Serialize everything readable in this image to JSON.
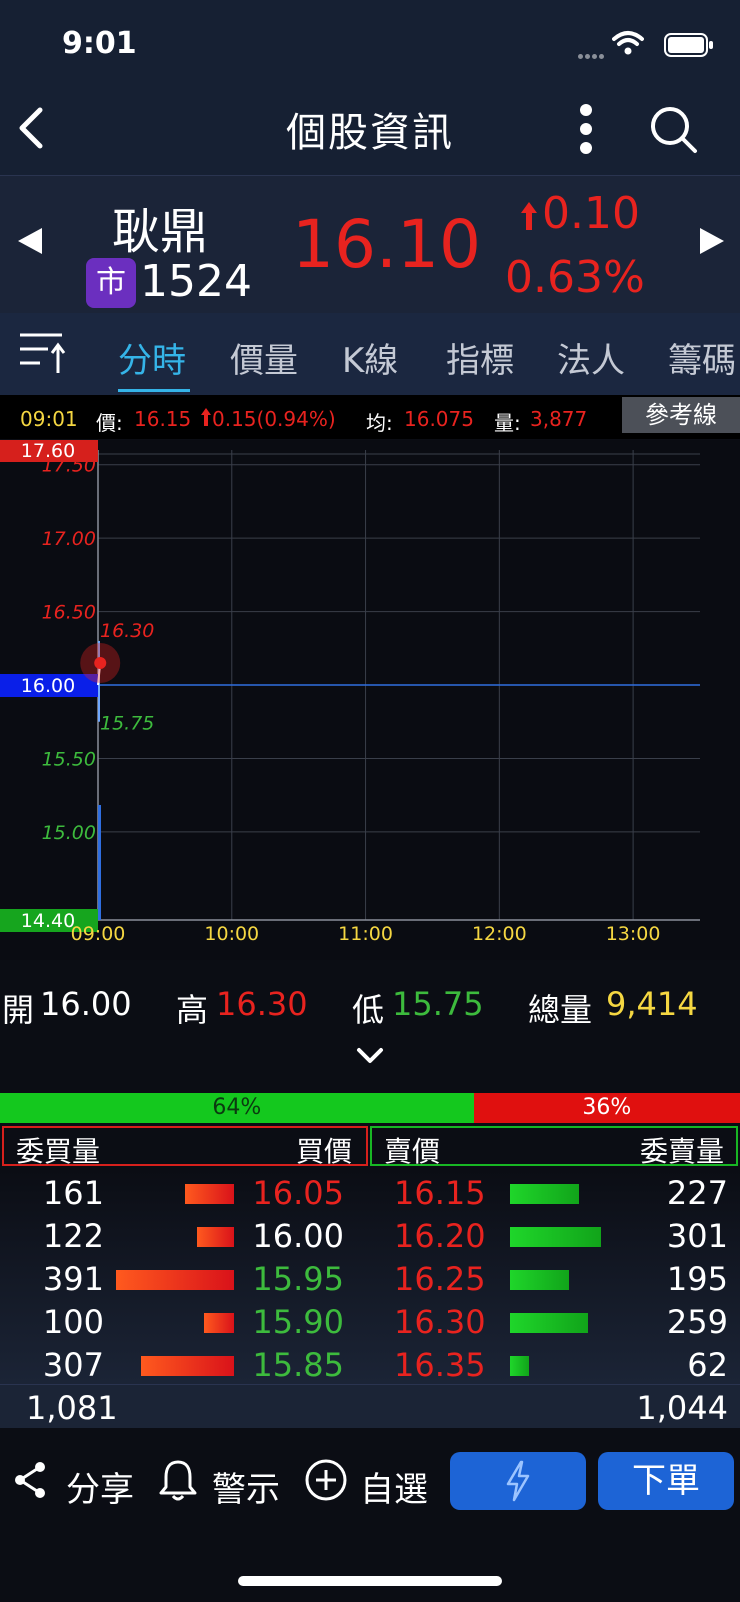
{
  "status": {
    "time": "9:01"
  },
  "nav": {
    "title": "個股資訊"
  },
  "quote": {
    "name": "耿鼎",
    "market_badge": "市",
    "code": "1524",
    "price": "16.10",
    "change": "0.10",
    "change_pct": "0.63%"
  },
  "tabs": [
    "分時",
    "價量",
    "K線",
    "指標",
    "法人",
    "籌碼"
  ],
  "info": {
    "time": "09:01",
    "price_label": "價:",
    "price": "16.15",
    "change": "0.15(0.94%)",
    "avg_label": "均:",
    "avg": "16.075",
    "vol_label": "量:",
    "vol": "3,877",
    "ref_button": "參考線"
  },
  "chart_data": {
    "type": "line",
    "title": "",
    "xlabel": "",
    "ylabel": "",
    "x_ticks": [
      "09:00",
      "10:00",
      "11:00",
      "12:00",
      "13:00"
    ],
    "y_ticks": [
      "17.50",
      "17.00",
      "16.50",
      "16.00",
      "15.50",
      "15.00"
    ],
    "limit_up": "17.60",
    "limit_down": "14.40",
    "reference": "16.00",
    "high_label": "16.30",
    "low_label": "15.75",
    "ylim": [
      14.4,
      17.6
    ],
    "xlim": [
      "09:00",
      "13:30"
    ],
    "series": [
      {
        "x": [
          "09:00",
          "09:01"
        ],
        "y": [
          16.0,
          16.15
        ]
      }
    ],
    "colors": {
      "up": "#e8231f",
      "down": "#3dbb3d",
      "ref": "#2f6ee0",
      "grid": "#3a3f4a"
    }
  },
  "ohlv": {
    "open_label": "開",
    "open": "16.00",
    "high_label": "高",
    "high": "16.30",
    "low_label": "低",
    "low": "15.75",
    "vol_label": "總量",
    "vol": "9,414"
  },
  "ratio": {
    "buy_pct": 64,
    "buy": "64%",
    "sell": "36%"
  },
  "book": {
    "buy_qty_label": "委買量",
    "buy_price_label": "買價",
    "sell_price_label": "賣價",
    "sell_qty_label": "委賣量",
    "rows": [
      {
        "bq": "161",
        "bq_n": 161,
        "bp": "16.05",
        "bp_color": "#e8231f",
        "sp": "16.15",
        "sq": "227",
        "sq_n": 227
      },
      {
        "bq": "122",
        "bq_n": 122,
        "bp": "16.00",
        "bp_color": "#ffffff",
        "sp": "16.20",
        "sq": "301",
        "sq_n": 301
      },
      {
        "bq": "391",
        "bq_n": 391,
        "bp": "15.95",
        "bp_color": "#3dbb3d",
        "sp": "16.25",
        "sq": "195",
        "sq_n": 195
      },
      {
        "bq": "100",
        "bq_n": 100,
        "bp": "15.90",
        "bp_color": "#3dbb3d",
        "sp": "16.30",
        "sq": "259",
        "sq_n": 259
      },
      {
        "bq": "307",
        "bq_n": 307,
        "bp": "15.85",
        "bp_color": "#3dbb3d",
        "sp": "16.35",
        "sq": "62",
        "sq_n": 62
      }
    ],
    "total_buy": "1,081",
    "total_sell": "1,044"
  },
  "bottom": {
    "share": "分享",
    "alert": "警示",
    "watch": "自選",
    "order": "下單"
  }
}
